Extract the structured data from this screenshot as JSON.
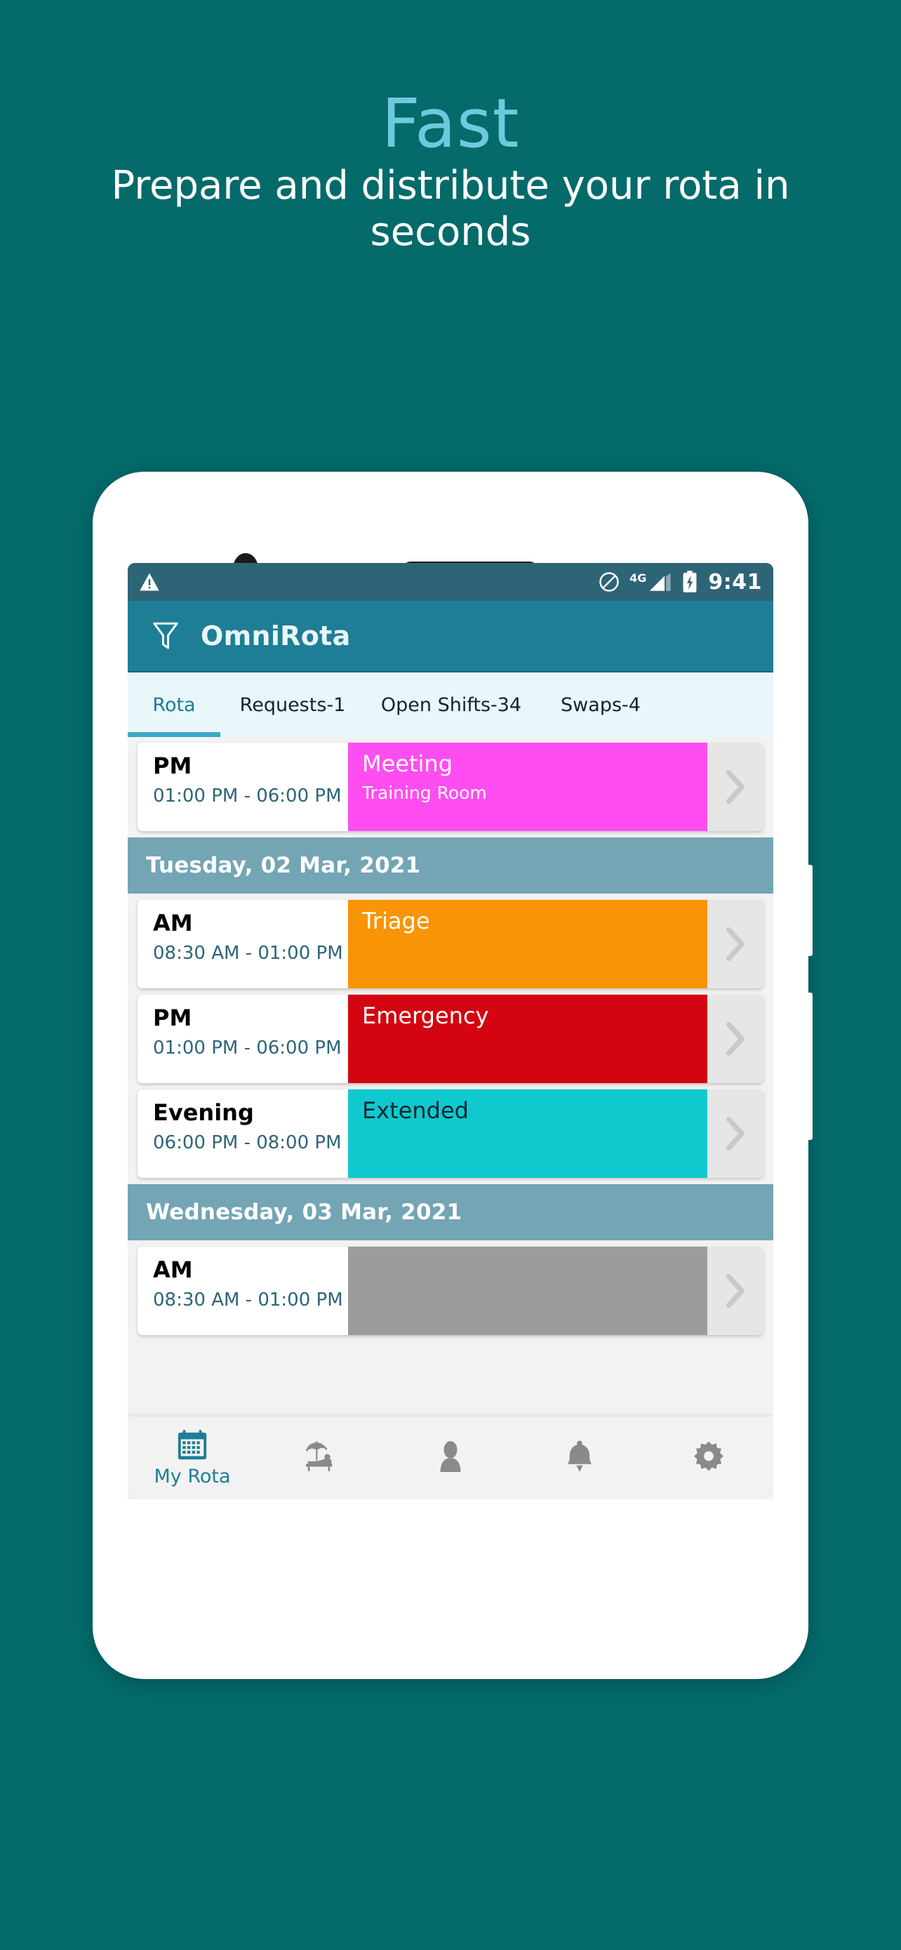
{
  "promo": {
    "headline": "Fast",
    "subtitle": "Prepare and distribute your rota in seconds",
    "background_color": "#046A6A",
    "headline_color": "#6FC9DE",
    "subtitle_color": "#FFFFFF"
  },
  "statusbar": {
    "warning_icon": "warning-triangle-icon",
    "dnd_icon": "do-not-disturb-icon",
    "network_label": "4G",
    "signal_icon": "signal-bars-icon",
    "battery_icon": "battery-charging-icon",
    "time": "9:41",
    "background_color": "#2D6577"
  },
  "appbar": {
    "filter_icon": "funnel-filter-icon",
    "title": "OmniRota",
    "background_color": "#1E7E96"
  },
  "tabs": {
    "items": [
      {
        "label": "Rota",
        "active": true
      },
      {
        "label": "Requests-1",
        "active": false
      },
      {
        "label": "Open Shifts-34",
        "active": false
      },
      {
        "label": "Swaps-4",
        "active": false
      }
    ],
    "active_color": "#177E96",
    "indicator_color": "#3BA9C6",
    "background_color": "#E9F7FB"
  },
  "rota": {
    "rows": [
      {
        "kind": "shift",
        "period": "PM",
        "time": "01:00 PM - 06:00 PM",
        "title": "Meeting",
        "subtitle": "Training Room",
        "color": "#FF4DF2",
        "text_color": "#FFFFFF",
        "chevron_icon": "chevron-right-icon"
      },
      {
        "kind": "date",
        "label": "Tuesday, 02 Mar, 2021"
      },
      {
        "kind": "shift",
        "period": "AM",
        "time": "08:30 AM - 01:00 PM",
        "title": "Triage",
        "subtitle": "",
        "color": "#F89406",
        "text_color": "#FFFFFF",
        "chevron_icon": "chevron-right-icon"
      },
      {
        "kind": "shift",
        "period": "PM",
        "time": "01:00 PM - 06:00 PM",
        "title": "Emergency",
        "subtitle": "",
        "color": "#D40511",
        "text_color": "#FFFFFF",
        "chevron_icon": "chevron-right-icon"
      },
      {
        "kind": "shift",
        "period": "Evening",
        "time": "06:00 PM - 08:00 PM",
        "title": "Extended",
        "subtitle": "",
        "color": "#0FC9CE",
        "text_color": "#0A2530",
        "chevron_icon": "chevron-right-icon"
      },
      {
        "kind": "date",
        "label": "Wednesday, 03 Mar, 2021"
      },
      {
        "kind": "shift",
        "period": "AM",
        "time": "08:30 AM - 01:00 PM",
        "title": "",
        "subtitle": "",
        "color": "#9C9C9C",
        "text_color": "#FFFFFF",
        "chevron_icon": "chevron-right-icon"
      }
    ],
    "date_header_color": "#73A5B4"
  },
  "bottomnav": {
    "items": [
      {
        "icon": "calendar-icon",
        "label": "My Rota",
        "active": true
      },
      {
        "icon": "beach-umbrella-icon",
        "label": "",
        "active": false
      },
      {
        "icon": "person-icon",
        "label": "",
        "active": false
      },
      {
        "icon": "bell-icon",
        "label": "",
        "active": false
      },
      {
        "icon": "gear-icon",
        "label": "",
        "active": false
      }
    ],
    "active_color": "#1E7E96",
    "inactive_color": "#8A8A8A"
  }
}
